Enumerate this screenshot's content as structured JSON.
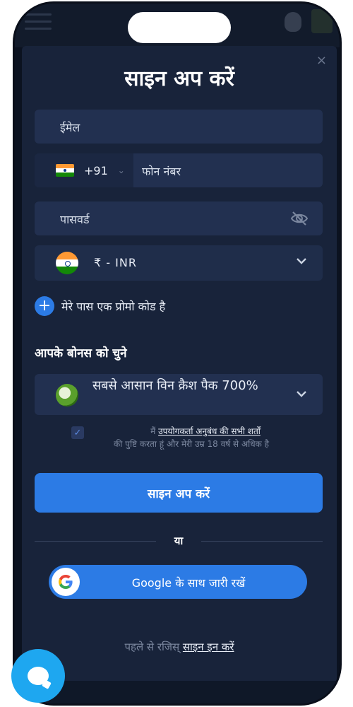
{
  "modal": {
    "title": "साइन अप करें",
    "close_glyph": "×"
  },
  "form": {
    "email_placeholder": "ईमेल",
    "phone": {
      "country_code": "+91",
      "placeholder": "फोन नंबर"
    },
    "password_placeholder": "पासवर्ड",
    "currency": {
      "symbol": "₹",
      "separator": "-",
      "code": "INR"
    },
    "promo_label": "मेरे पास एक प्रोमो कोड है"
  },
  "bonus": {
    "heading": "आपके बोनस को चुने",
    "selected": "सबसे आसान विन क्रैश पैक 700%"
  },
  "agreement": {
    "prefix": "मैं",
    "link": "उपयोगकर्ता अनुबंध की सभी शर्तों",
    "suffix": "की पुष्टि करता हूं और मेरी उम्र 18 वर्ष से अधिक है",
    "checked": true
  },
  "actions": {
    "signup_label": "साइन अप करें",
    "or_label": "या",
    "google_label": "Google के साथ जारी रखें"
  },
  "login": {
    "prefix": "पहले से रजिस्",
    "link": "साइन इन करें"
  },
  "colors": {
    "accent": "#2c7be5",
    "modal_bg": "#18233a",
    "field_bg": "#223050",
    "chat": "#1ea7f0"
  },
  "icons": [
    "hamburger-icon",
    "apple-icon",
    "close-icon",
    "india-flag-icon",
    "chevron-down-icon",
    "eye-off-icon",
    "plus-icon",
    "bonus-icon",
    "checkbox-icon",
    "google-icon",
    "chat-icon"
  ]
}
